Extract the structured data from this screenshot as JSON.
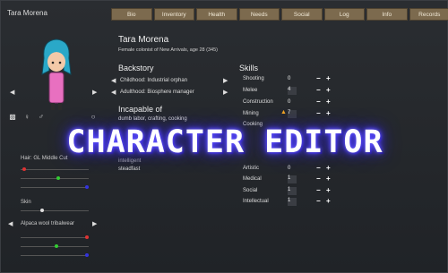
{
  "window": {
    "title": "Tara Morena"
  },
  "tabs": [
    "Bio",
    "Inventory",
    "Health",
    "Needs",
    "Social",
    "Log",
    "Info",
    "Records"
  ],
  "header": {
    "name": "Tara Morena",
    "subtitle": "Female colonist of New Arrivals, age 28 (345)"
  },
  "backstory": {
    "heading": "Backstory",
    "childhood": "Childhood: Industrial orphan",
    "adulthood": "Adulthood: Biosphere manager"
  },
  "incapable": {
    "heading": "Incapable of",
    "text": "dumb labor, crafting, cooking"
  },
  "traits": {
    "partial": "steadfast",
    "partial_top": "intelligent"
  },
  "left_panel": {
    "hair_label": "Hair: GL Middle Cut",
    "skin_label": "Skin",
    "apparel_label": "Alpaca wool tribalwear"
  },
  "skills": {
    "heading": "Skills",
    "items": [
      {
        "name": "Shooting",
        "value": "0",
        "boxed": false
      },
      {
        "name": "Melee",
        "value": "4",
        "boxed": true
      },
      {
        "name": "Construction",
        "value": "0",
        "boxed": false
      },
      {
        "name": "Mining",
        "value": "7",
        "boxed": true,
        "flame": true
      },
      {
        "name": "Cooking",
        "value": "",
        "boxed": false
      },
      {
        "name": "Artistic",
        "value": "0",
        "boxed": false
      },
      {
        "name": "Medical",
        "value": "1",
        "boxed": true
      },
      {
        "name": "Social",
        "value": "1",
        "boxed": true
      },
      {
        "name": "Intellectual",
        "value": "1",
        "boxed": true
      }
    ]
  },
  "overlay": {
    "text": "CHARACTER EDITOR"
  },
  "colors": {
    "tab": "#7c6a4e",
    "overlay_glow": "#4b3dff",
    "hair": "#2aa8c8",
    "dress": "#e870c0"
  }
}
